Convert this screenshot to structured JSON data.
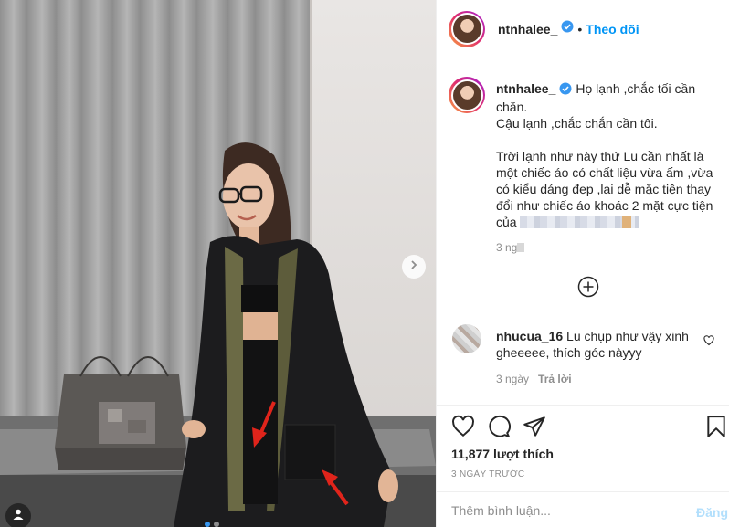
{
  "post": {
    "author": {
      "username": "ntnhalee_",
      "verified": true,
      "follow_label": "Theo dõi",
      "separator": "•"
    },
    "caption": {
      "username": "ntnhalee_",
      "lines": [
        "Họ lạnh ,chắc tối cần chăn.",
        "Cậu lạnh ,chắc chắn cần tôi.",
        "",
        "Trời lạnh như này thứ Lu cần nhất là một chiếc áo có chất liệu vừa ấm ,vừa có kiểu dáng đẹp ,lại dễ mặc tiện thay đổi như chiếc áo khoác 2 mặt cực tiện của"
      ],
      "time": "3 ng"
    },
    "comments": [
      {
        "username": "nhucua_16",
        "text": "Lu chụp như vậy xinh gheeeee, thích góc nàyyy",
        "time": "3 ngày",
        "reply_label": "Trả lời"
      }
    ],
    "likes_label": "11,877 lượt thích",
    "date_label": "3 NGÀY TRƯỚC",
    "add_comment": {
      "placeholder": "Thêm bình luận...",
      "post_label": "Đăng"
    },
    "carousel": {
      "slides": 2,
      "active_index": 0
    }
  },
  "icons": {
    "verified": "verified-badge-icon",
    "next": "chevron-right-icon",
    "user_tag": "user-tag-icon",
    "load_more": "plus-circle-icon",
    "like": "heart-icon",
    "comment": "comment-bubble-icon",
    "share": "paper-plane-icon",
    "save": "bookmark-icon"
  },
  "colors": {
    "accent": "#0095f6",
    "verified": "#3897f0",
    "muted": "#8e8e8e",
    "border": "#efefef",
    "post_disabled": "#b2dffc",
    "arrow_annotation": "#e0241b"
  }
}
